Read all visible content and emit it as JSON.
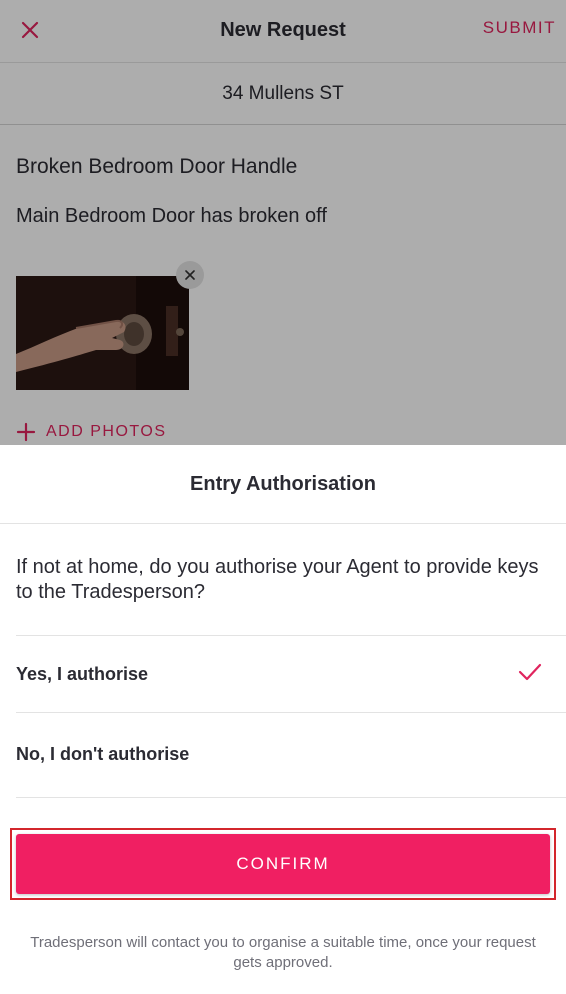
{
  "header": {
    "title": "New Request",
    "submit_label": "SUBMIT",
    "close_icon": "close-icon"
  },
  "address": "34 Mullens ST",
  "request": {
    "title": "Broken Bedroom Door Handle",
    "description": "Main Bedroom Door has broken off",
    "add_photos_label": "ADD PHOTOS"
  },
  "sheet": {
    "title": "Entry Authorisation",
    "question": "If not at home, do you authorise your Agent to provide keys to the Tradesperson?",
    "options": [
      {
        "label": "Yes, I authorise",
        "selected": true
      },
      {
        "label": "No, I don't authorise",
        "selected": false
      }
    ],
    "confirm_label": "CONFIRM",
    "footnote": "Tradesperson will contact you to organise a suitable time, once your request gets approved."
  },
  "colors": {
    "accent": "#e0245e",
    "confirm_bg": "#f01f62",
    "highlight_border": "#d3262c"
  }
}
